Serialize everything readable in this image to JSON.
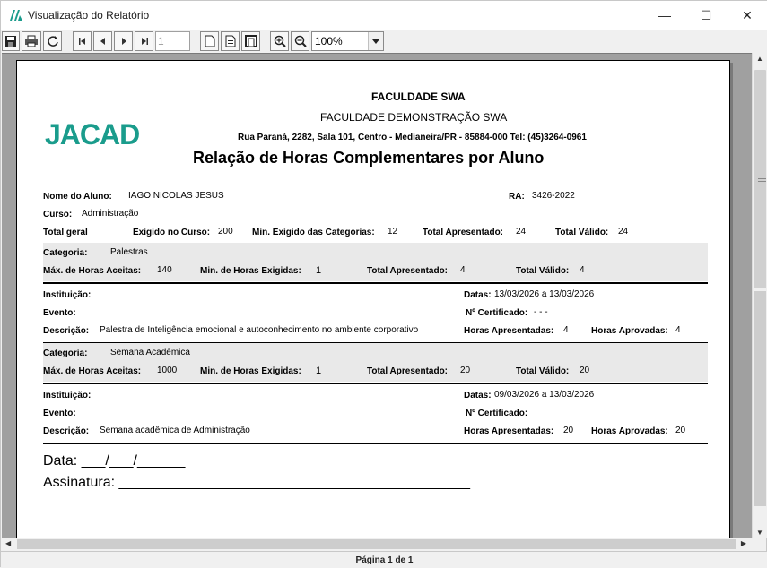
{
  "window": {
    "title": "Visualização do Relatório",
    "min_glyph": "—",
    "max_glyph": "☐",
    "close_glyph": "✕"
  },
  "toolbar": {
    "page_value": "1",
    "zoom": "100%"
  },
  "report": {
    "logo_text": "JACAD",
    "institution_name": "FACULDADE SWA",
    "institution_subtitle": "FACULDADE DEMONSTRAÇÃO SWA",
    "address": "Rua Paraná, 2282, Sala 101, Centro - Medianeira/PR - 85884-000 Tel: (45)3264-0961",
    "report_title": "Relação de Horas Complementares por Aluno",
    "student_label": "Nome do Aluno:",
    "student_name": "IAGO NICOLAS JESUS",
    "ra_label": "RA:",
    "ra_value": "3426-2022",
    "course_label": "Curso:",
    "course_value": "Administração",
    "totals": {
      "total_geral_label": "Total geral",
      "exigido_label": "Exigido no Curso:",
      "exigido_value": "200",
      "min_cat_label": "Min. Exigido das Categorias:",
      "min_cat_value": "12",
      "apresentado_label": "Total Apresentado:",
      "apresentado_value": "24",
      "valido_label": "Total Válido:",
      "valido_value": "24"
    },
    "categories": [
      {
        "cat_label": "Categoria:",
        "cat_name": "Palestras",
        "max_label": "Máx. de Horas Aceitas:",
        "max_value": "140",
        "min_label": "Min. de Horas Exigidas:",
        "min_value": "1",
        "apres_label": "Total Apresentado:",
        "apres_value": "4",
        "valido_label": "Total Válido:",
        "valido_value": "4",
        "inst_label": "Instituição:",
        "evento_label": "Evento:",
        "desc_label": "Descrição:",
        "desc_value": "Palestra de Inteligência emocional e autoconhecimento no ambiente corporativo",
        "datas_label": "Datas:",
        "datas_value": "13/03/2026 a 13/03/2026",
        "cert_label": "Nº Certificado:",
        "cert_value": "- - -",
        "horas_apres_label": "Horas Apresentadas:",
        "horas_apres_value": "4",
        "horas_aprov_label": "Horas Aprovadas:",
        "horas_aprov_value": "4"
      },
      {
        "cat_label": "Categoria:",
        "cat_name": "Semana Acadêmica",
        "max_label": "Máx. de Horas Aceitas:",
        "max_value": "1000",
        "min_label": "Min. de Horas Exigidas:",
        "min_value": "1",
        "apres_label": "Total Apresentado:",
        "apres_value": "20",
        "valido_label": "Total Válido:",
        "valido_value": "20",
        "inst_label": "Instituição:",
        "evento_label": "Evento:",
        "desc_label": "Descrição:",
        "desc_value": "Semana acadêmica de Administração",
        "datas_label": "Datas:",
        "datas_value": "09/03/2026 a 13/03/2026",
        "cert_label": "Nº Certificado:",
        "cert_value": "",
        "horas_apres_label": "Horas Apresentadas:",
        "horas_apres_value": "20",
        "horas_aprov_label": "Horas Aprovadas:",
        "horas_aprov_value": "20"
      }
    ],
    "data_line": "Data: ___/___/______",
    "signature_line": "Assinatura: ____________________________________________"
  },
  "status": {
    "page_info": "Página 1 de 1"
  },
  "colors": {
    "logo": "#1a9c8c",
    "viewer_bg": "#a0a0a0",
    "category_band": "#e9e9e9"
  }
}
